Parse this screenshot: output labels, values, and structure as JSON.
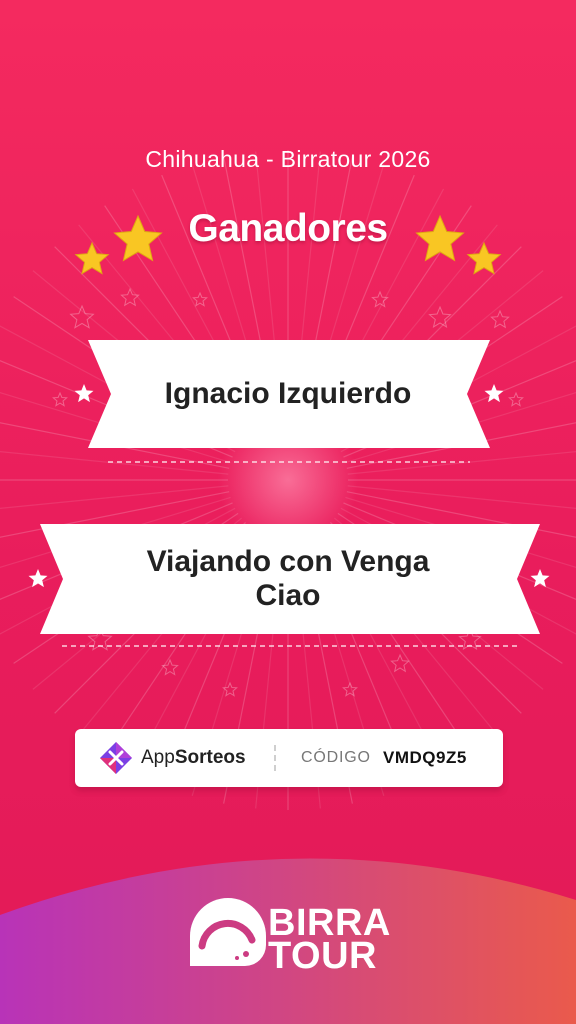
{
  "header": {
    "subtitle": "Chihuahua - Birratour 2026",
    "title": "Ganadores"
  },
  "winners": [
    {
      "name": "Ignacio Izquierdo"
    },
    {
      "name_line1": "Viajando con Venga",
      "name_line2": "Ciao"
    }
  ],
  "badge": {
    "brand_light": "App",
    "brand_bold": "Sorteos",
    "code_label": "CÓDIGO",
    "code_value": "VMDQ9Z5"
  },
  "footer": {
    "logo_line1": "BIRRA",
    "logo_line2": "TOUR"
  },
  "colors": {
    "background": "#f42a5f",
    "banner": "#ffffff",
    "star": "#f9c623",
    "footer_gradient": [
      "#b833b8",
      "#ea5a4c"
    ]
  }
}
